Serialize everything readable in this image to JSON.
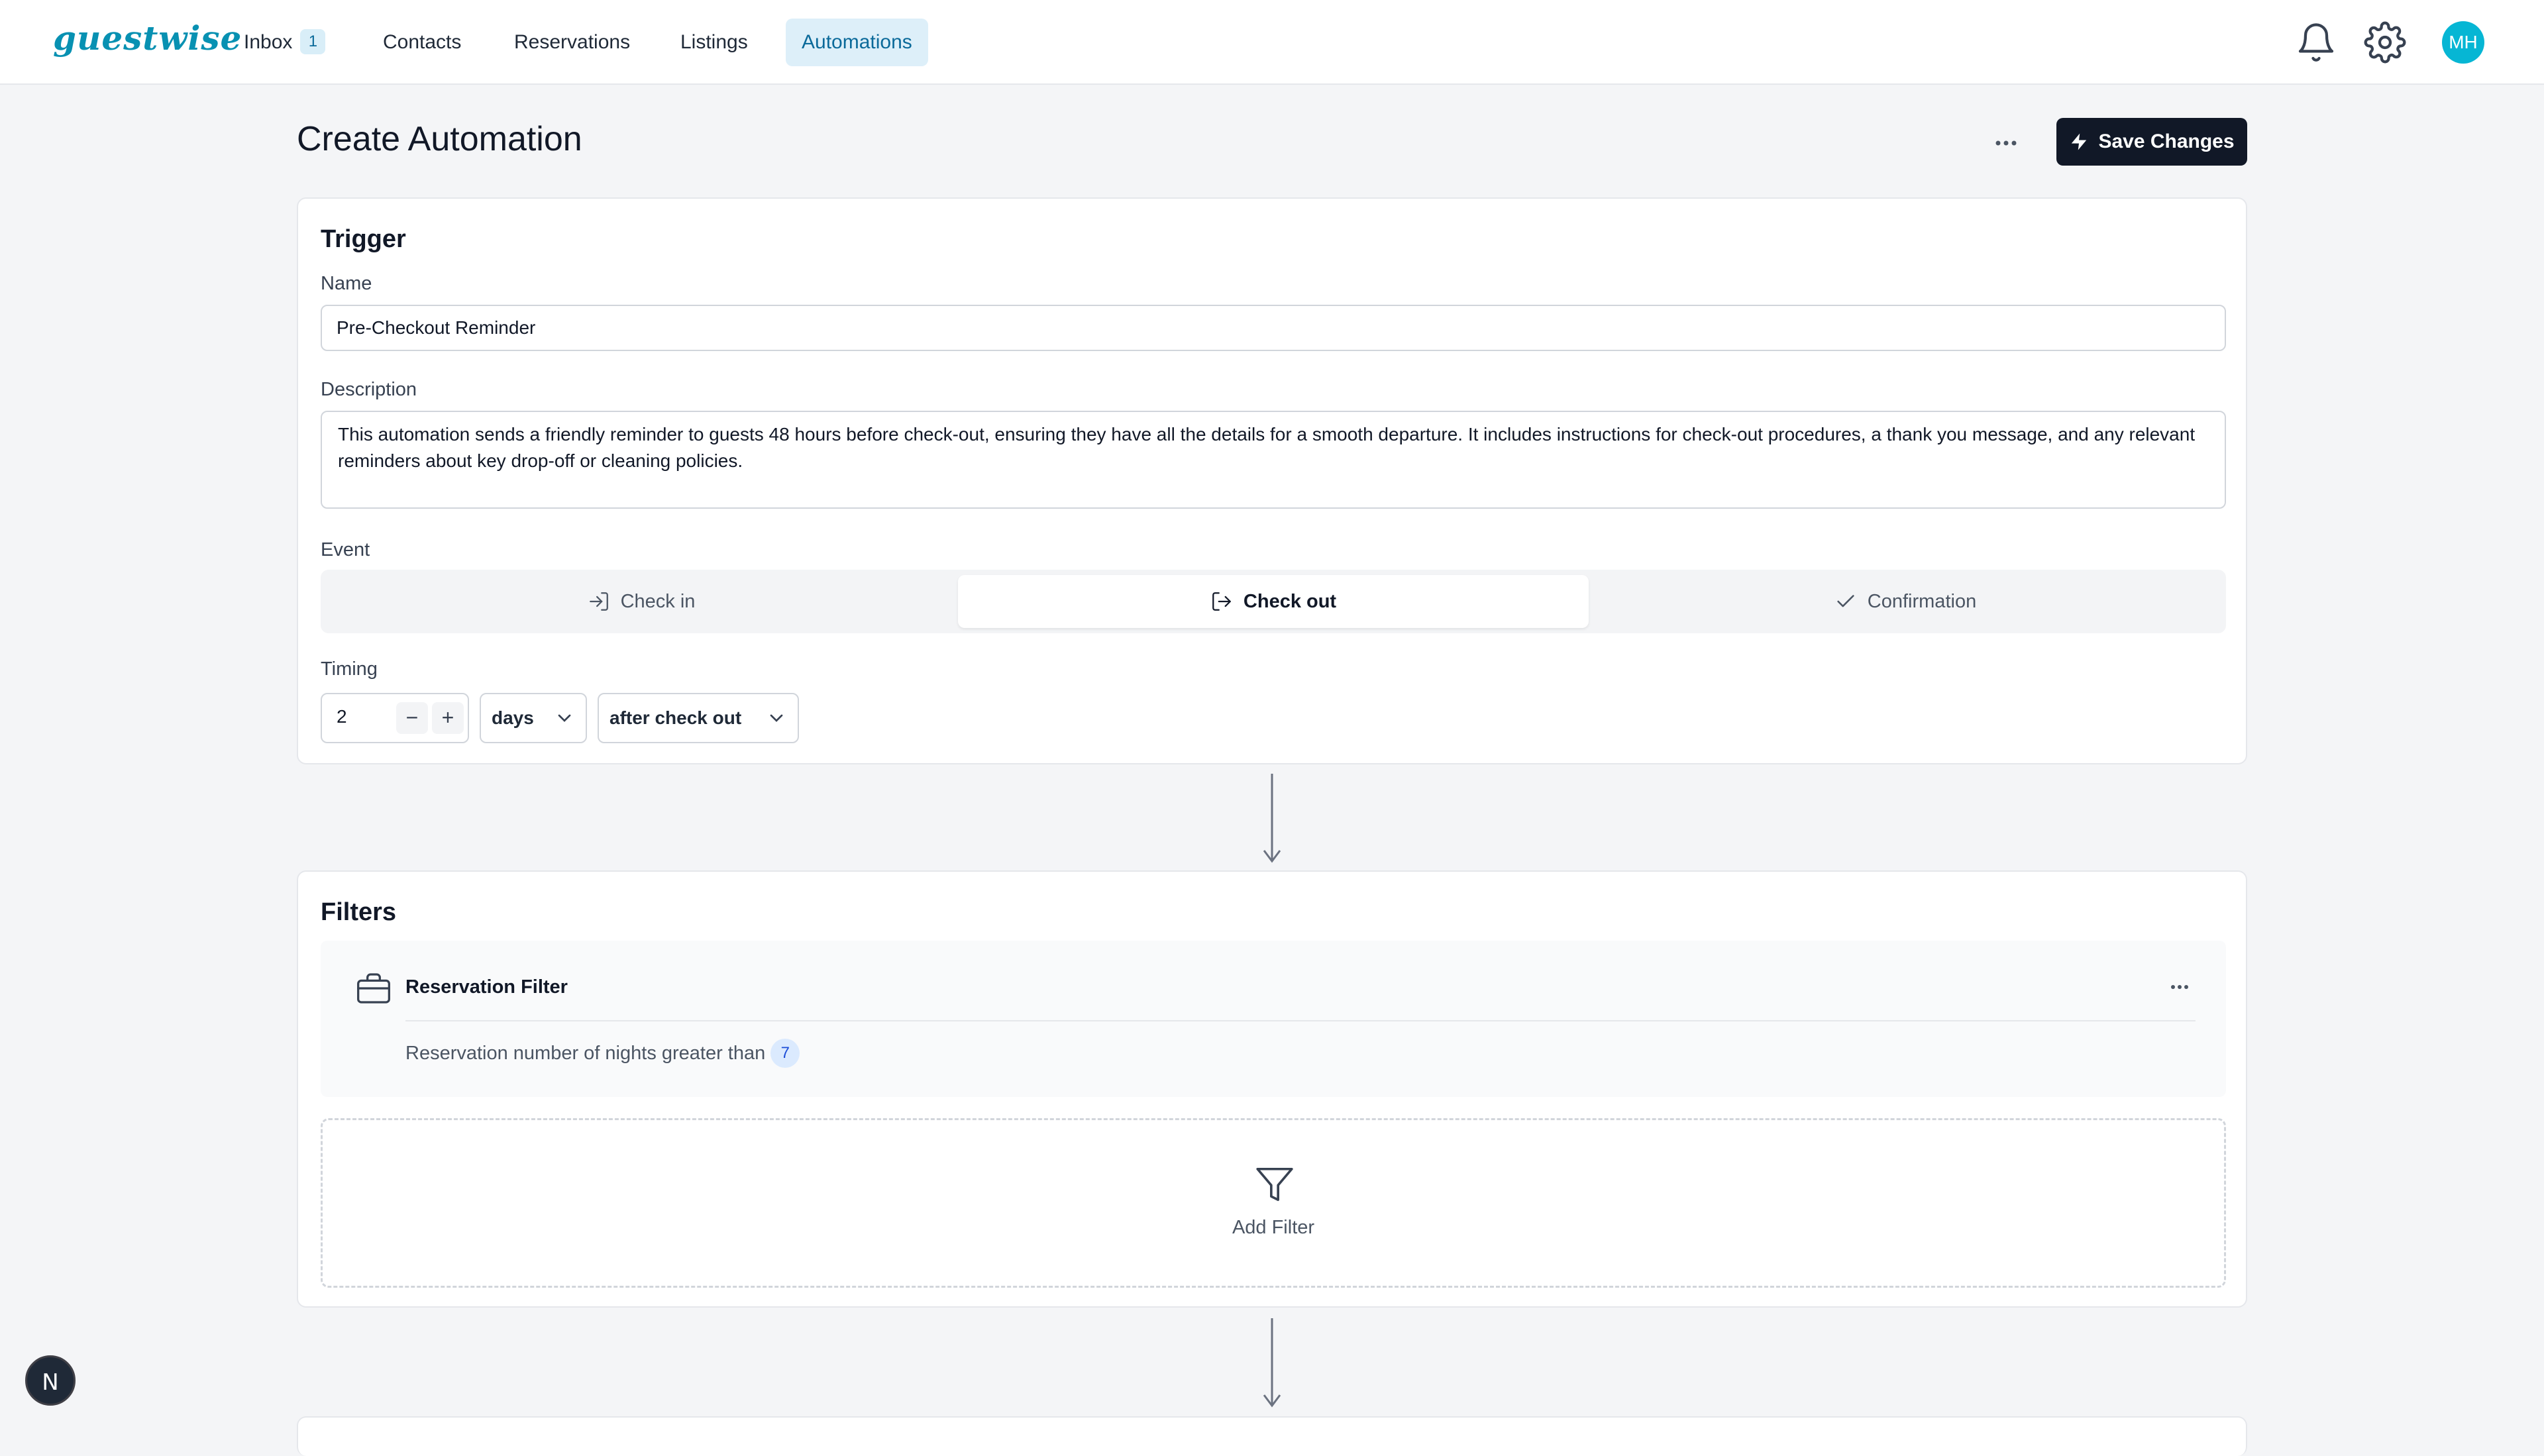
{
  "app": {
    "logo": "guestwise"
  },
  "nav": {
    "inbox": {
      "label": "Inbox",
      "badge": "1"
    },
    "contacts": "Contacts",
    "reservations": "Reservations",
    "listings": "Listings",
    "automations": "Automations",
    "active": "Automations"
  },
  "user": {
    "initials": "MH"
  },
  "header": {
    "title": "Create Automation",
    "save_label": "Save Changes"
  },
  "trigger": {
    "title": "Trigger",
    "name_label": "Name",
    "name_value": "Pre-Checkout Reminder",
    "description_label": "Description",
    "description_value": "This automation sends a friendly reminder to guests 48 hours before check-out, ensuring they have all the details for a smooth departure. It includes instructions for check-out procedures, a thank you message, and any relevant reminders about key drop-off or cleaning policies.",
    "event_label": "Event",
    "events": [
      {
        "label": "Check in",
        "icon": "login-icon"
      },
      {
        "label": "Check out",
        "icon": "logout-icon"
      },
      {
        "label": "Confirmation",
        "icon": "check-icon"
      }
    ],
    "selected_event": "Check out",
    "timing_label": "Timing",
    "timing_value": "2",
    "timing_unit": "days",
    "timing_relation": "after check out"
  },
  "filters": {
    "title": "Filters",
    "items": [
      {
        "title": "Reservation Filter",
        "icon": "briefcase-icon",
        "condition": "Reservation number of nights greater than",
        "value": "7"
      }
    ],
    "add_label": "Add Filter"
  },
  "dev_badge": "N",
  "colors": {
    "accent": "#0891b2",
    "primary_button": "#111827",
    "avatar": "#06b6d4"
  }
}
